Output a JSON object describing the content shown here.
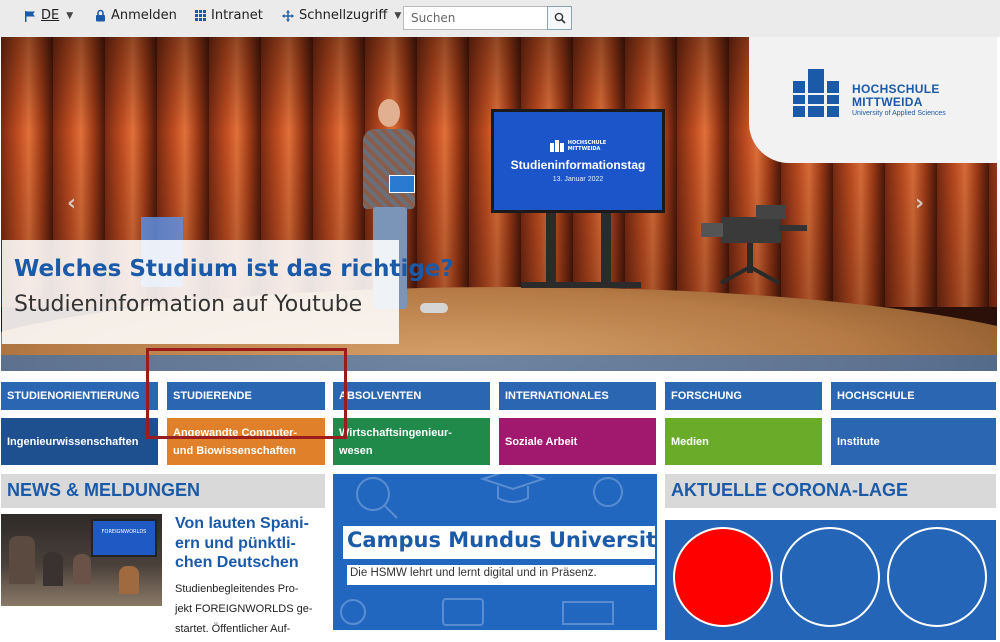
{
  "topbar": {
    "language": "DE",
    "login": "Anmelden",
    "intranet": "Intranet",
    "quick_access": "Schnellzugriff",
    "search_placeholder": "Suchen"
  },
  "hero": {
    "logo_line1": "HOCHSCHULE",
    "logo_line2": "MITTWEIDA",
    "logo_tagline": "University of Applied Sciences",
    "screen_logo1": "HOCHSCHULE",
    "screen_logo2": "MITTWEIDA",
    "screen_title": "Studieninformationstag",
    "screen_date": "13. Januar 2022",
    "caption_title": "Welches Studium ist das richtige?",
    "caption_subtitle": "Studieninformation auf Youtube"
  },
  "nav": {
    "tiles": [
      {
        "label": "STUDIENORIENTIERUNG"
      },
      {
        "label": "STUDIERENDE"
      },
      {
        "label": "ABSOLVENTEN"
      },
      {
        "label": "INTERNATIONALES"
      },
      {
        "label": "FORSCHUNG"
      },
      {
        "label": "HOCHSCHULE"
      }
    ],
    "subtiles": [
      {
        "line1": "Ingenieurwissenschaften",
        "line2": "",
        "color": "#1e4f8f"
      },
      {
        "line1": "Angewandte Computer-",
        "line2": "und Biowissenschaften",
        "color": "#e0802a"
      },
      {
        "line1": "Wirtschaftsingenieur-",
        "line2": "wesen",
        "color": "#1f8a4a"
      },
      {
        "line1": "Soziale Arbeit",
        "line2": "",
        "color": "#a1196e"
      },
      {
        "line1": "Medien",
        "line2": "",
        "color": "#6aab2a"
      },
      {
        "line1": "Institute",
        "line2": "",
        "color": "#2b66b3"
      }
    ]
  },
  "news": {
    "heading": "NEWS & MELDUNGEN",
    "image_label": "FOREIGNWORLDS",
    "title_lines": [
      "Von lauten Spani-",
      "ern und pünktli-",
      "chen Deutschen"
    ],
    "text_lines": [
      "Studienbegleitendes Pro-",
      "jekt FOREIGNWORLDS ge-",
      "startet. Öffentlicher Auf-"
    ]
  },
  "campus": {
    "title": "Campus Mundus University",
    "subtitle": "Die HSMW lehrt und lernt digital und in Präsenz."
  },
  "corona": {
    "heading": "AKTUELLE CORONA-LAGE",
    "lights": [
      "#ff0000",
      "#2565b8",
      "#2565b8"
    ]
  }
}
